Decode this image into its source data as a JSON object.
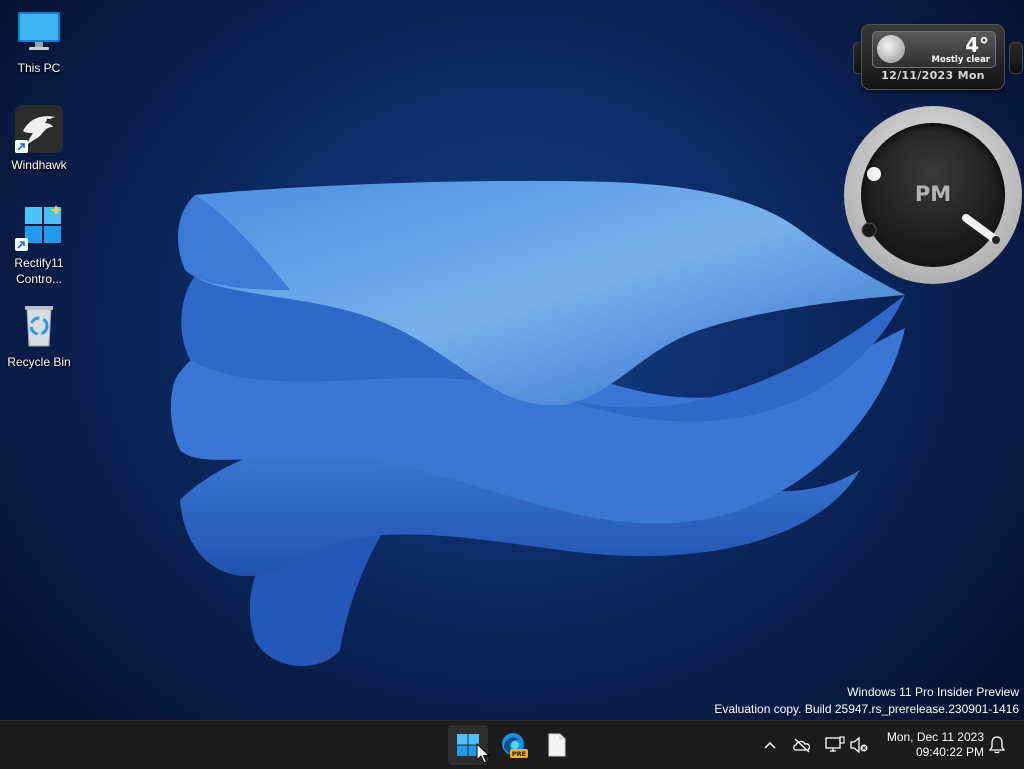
{
  "desktop": {
    "icons": [
      {
        "label": "This PC",
        "icon": "monitor-icon"
      },
      {
        "label": "Windhawk",
        "icon": "eagle-icon"
      },
      {
        "label": "Rectify11 Contro...",
        "icon": "windows-logo-icon"
      },
      {
        "label": "Recycle Bin",
        "icon": "recycle-bin-icon"
      }
    ]
  },
  "weather_gadget": {
    "temperature": "4°",
    "condition": "Mostly clear",
    "date": "12/11/2023 Mon",
    "icon": "moon-icon"
  },
  "clock_gadget": {
    "ampm": "PM"
  },
  "watermark": {
    "line1": "Windows 11 Pro Insider Preview",
    "line2": "Evaluation copy. Build 25947.rs_prerelease.230901-1416"
  },
  "taskbar": {
    "pinned": [
      {
        "name": "Start",
        "icon": "windows-start-icon"
      },
      {
        "name": "Microsoft Edge Preview",
        "icon": "edge-pre-icon",
        "badge": "PRE"
      },
      {
        "name": "File",
        "icon": "file-icon"
      }
    ],
    "tray": {
      "icons": [
        "chevron-up-icon",
        "onedrive-offline-icon",
        "network-icon",
        "volume-muted-icon"
      ],
      "date": "Mon, Dec 11 2023",
      "time": "09:40:22 PM"
    }
  },
  "colors": {
    "taskbar": "#1c1c1c",
    "accent": "#0078d4",
    "wallpaper_bg": "#0a2050"
  }
}
